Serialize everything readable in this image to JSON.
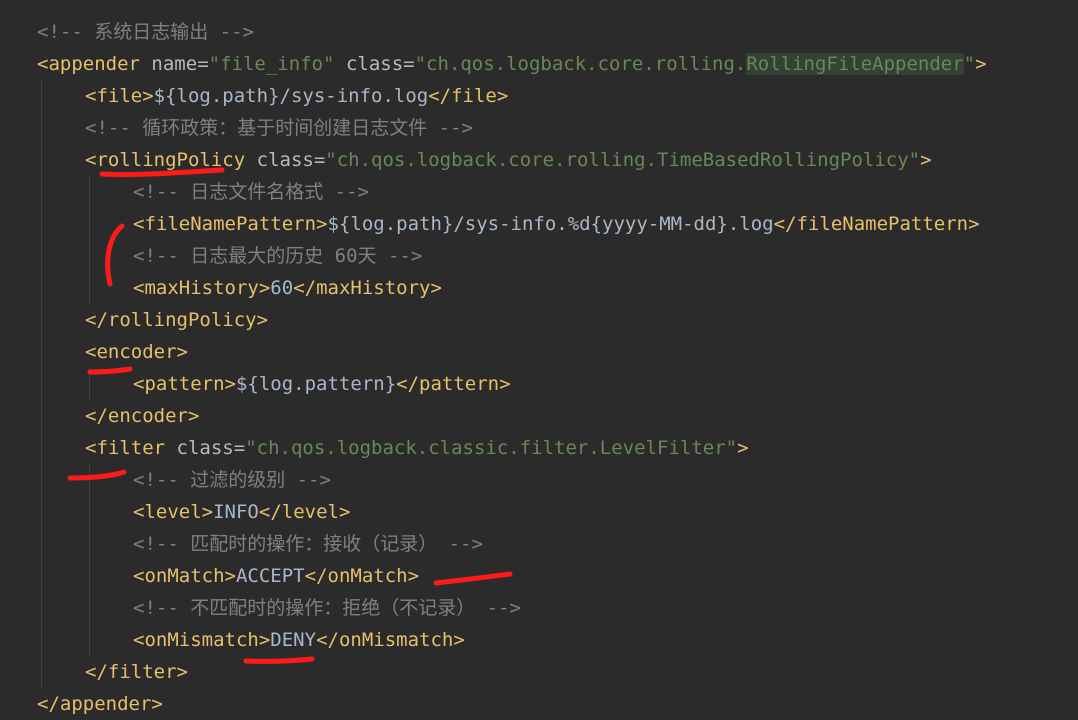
{
  "editor": {
    "colors": {
      "background": "#2b2b2b",
      "tag": "#e8bf6a",
      "attribute": "#bababa",
      "string": "#6a8759",
      "comment": "#808080",
      "text": "#a9b7c6",
      "annotation": "#ff1a1a"
    },
    "lines": [
      {
        "indent": 0,
        "tokens": [
          {
            "k": "cmt",
            "t": "<!-- 系统日志输出 -->"
          }
        ]
      },
      {
        "indent": 0,
        "tokens": [
          {
            "k": "brk",
            "t": "<"
          },
          {
            "k": "tag",
            "t": "appender"
          },
          {
            "k": "txt",
            "t": " "
          },
          {
            "k": "attr",
            "t": "name"
          },
          {
            "k": "txt",
            "t": "="
          },
          {
            "k": "str",
            "t": "\"file_info\""
          },
          {
            "k": "txt",
            "t": " "
          },
          {
            "k": "attr",
            "t": "class"
          },
          {
            "k": "txt",
            "t": "="
          },
          {
            "k": "str",
            "t": "\"ch.qos.logback.core.rolling."
          },
          {
            "k": "strhl",
            "t": "RollingFileAppender"
          },
          {
            "k": "str",
            "t": "\""
          },
          {
            "k": "brk",
            "t": ">"
          }
        ]
      },
      {
        "indent": 1,
        "tokens": [
          {
            "k": "brk",
            "t": "<"
          },
          {
            "k": "tag",
            "t": "file"
          },
          {
            "k": "brk",
            "t": ">"
          },
          {
            "k": "txt",
            "t": "${log.path}/sys-info.log"
          },
          {
            "k": "brk",
            "t": "</"
          },
          {
            "k": "tag",
            "t": "file"
          },
          {
            "k": "brk",
            "t": ">"
          }
        ]
      },
      {
        "indent": 1,
        "tokens": [
          {
            "k": "cmt",
            "t": "<!-- 循环政策：基于时间创建日志文件 -->"
          }
        ]
      },
      {
        "indent": 1,
        "tokens": [
          {
            "k": "brk",
            "t": "<"
          },
          {
            "k": "tag",
            "t": "rollingPolicy"
          },
          {
            "k": "txt",
            "t": " "
          },
          {
            "k": "attr",
            "t": "class"
          },
          {
            "k": "txt",
            "t": "="
          },
          {
            "k": "str",
            "t": "\"ch.qos.logback.core.rolling.TimeBasedRollingPolicy\""
          },
          {
            "k": "brk",
            "t": ">"
          }
        ]
      },
      {
        "indent": 2,
        "tokens": [
          {
            "k": "cmt",
            "t": "<!-- 日志文件名格式 -->"
          }
        ]
      },
      {
        "indent": 2,
        "tokens": [
          {
            "k": "brk",
            "t": "<"
          },
          {
            "k": "tag",
            "t": "fileNamePattern"
          },
          {
            "k": "brk",
            "t": ">"
          },
          {
            "k": "txt",
            "t": "${log.path}/sys-info.%d{yyyy-MM-dd}.log"
          },
          {
            "k": "brk",
            "t": "</"
          },
          {
            "k": "tag",
            "t": "fileNamePattern"
          },
          {
            "k": "brk",
            "t": ">"
          }
        ]
      },
      {
        "indent": 2,
        "tokens": [
          {
            "k": "cmt",
            "t": "<!-- 日志最大的历史 60天 -->"
          }
        ]
      },
      {
        "indent": 2,
        "tokens": [
          {
            "k": "brk",
            "t": "<"
          },
          {
            "k": "tag",
            "t": "maxHistory"
          },
          {
            "k": "brk",
            "t": ">"
          },
          {
            "k": "txt",
            "t": "60"
          },
          {
            "k": "brk",
            "t": "</"
          },
          {
            "k": "tag",
            "t": "maxHistory"
          },
          {
            "k": "brk",
            "t": ">"
          }
        ]
      },
      {
        "indent": 1,
        "tokens": [
          {
            "k": "brk",
            "t": "</"
          },
          {
            "k": "tag",
            "t": "rollingPolicy"
          },
          {
            "k": "brk",
            "t": ">"
          }
        ]
      },
      {
        "indent": 1,
        "tokens": [
          {
            "k": "brk",
            "t": "<"
          },
          {
            "k": "tag",
            "t": "encoder"
          },
          {
            "k": "brk",
            "t": ">"
          }
        ]
      },
      {
        "indent": 2,
        "tokens": [
          {
            "k": "brk",
            "t": "<"
          },
          {
            "k": "tag",
            "t": "pattern"
          },
          {
            "k": "brk",
            "t": ">"
          },
          {
            "k": "txt",
            "t": "${log.pattern}"
          },
          {
            "k": "brk",
            "t": "</"
          },
          {
            "k": "tag",
            "t": "pattern"
          },
          {
            "k": "brk",
            "t": ">"
          }
        ]
      },
      {
        "indent": 1,
        "tokens": [
          {
            "k": "brk",
            "t": "</"
          },
          {
            "k": "tag",
            "t": "encoder"
          },
          {
            "k": "brk",
            "t": ">"
          }
        ]
      },
      {
        "indent": 1,
        "tokens": [
          {
            "k": "brk",
            "t": "<"
          },
          {
            "k": "tag",
            "t": "filter"
          },
          {
            "k": "txt",
            "t": " "
          },
          {
            "k": "attr",
            "t": "class"
          },
          {
            "k": "txt",
            "t": "="
          },
          {
            "k": "str",
            "t": "\"ch.qos.logback.classic.filter.LevelFilter\""
          },
          {
            "k": "brk",
            "t": ">"
          }
        ]
      },
      {
        "indent": 2,
        "tokens": [
          {
            "k": "cmt",
            "t": "<!-- 过滤的级别 -->"
          }
        ]
      },
      {
        "indent": 2,
        "tokens": [
          {
            "k": "brk",
            "t": "<"
          },
          {
            "k": "tag",
            "t": "level"
          },
          {
            "k": "brk",
            "t": ">"
          },
          {
            "k": "txt",
            "t": "INFO"
          },
          {
            "k": "brk",
            "t": "</"
          },
          {
            "k": "tag",
            "t": "level"
          },
          {
            "k": "brk",
            "t": ">"
          }
        ]
      },
      {
        "indent": 2,
        "tokens": [
          {
            "k": "cmt",
            "t": "<!-- 匹配时的操作：接收（记录） -->"
          }
        ]
      },
      {
        "indent": 2,
        "tokens": [
          {
            "k": "brk",
            "t": "<"
          },
          {
            "k": "tag",
            "t": "onMatch"
          },
          {
            "k": "brk",
            "t": ">"
          },
          {
            "k": "txt",
            "t": "ACCEPT"
          },
          {
            "k": "brk",
            "t": "</"
          },
          {
            "k": "tag",
            "t": "onMatch"
          },
          {
            "k": "brk",
            "t": ">"
          }
        ]
      },
      {
        "indent": 2,
        "tokens": [
          {
            "k": "cmt",
            "t": "<!-- 不匹配时的操作：拒绝（不记录） -->"
          }
        ]
      },
      {
        "indent": 2,
        "tokens": [
          {
            "k": "brk",
            "t": "<"
          },
          {
            "k": "tag",
            "t": "onMismatch"
          },
          {
            "k": "brk",
            "t": ">"
          },
          {
            "k": "txt",
            "t": "DENY"
          },
          {
            "k": "brk",
            "t": "</"
          },
          {
            "k": "tag",
            "t": "onMismatch"
          },
          {
            "k": "brk",
            "t": ">"
          }
        ]
      },
      {
        "indent": 1,
        "tokens": [
          {
            "k": "brk",
            "t": "</"
          },
          {
            "k": "tag",
            "t": "filter"
          },
          {
            "k": "brk",
            "t": ">"
          }
        ]
      },
      {
        "indent": 0,
        "tokens": [
          {
            "k": "brk",
            "t": "</"
          },
          {
            "k": "tag",
            "t": "appender"
          },
          {
            "k": "brk",
            "t": ">"
          }
        ]
      }
    ]
  }
}
